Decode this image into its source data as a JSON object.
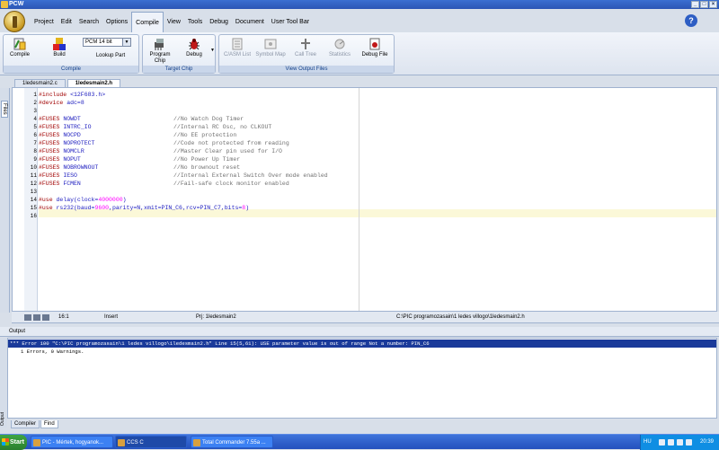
{
  "window": {
    "title": "PCW",
    "buttons": [
      "_",
      "□",
      "×"
    ]
  },
  "menu": {
    "tabs": [
      "Project",
      "Edit",
      "Search",
      "Options",
      "Compile",
      "View",
      "Tools",
      "Debug",
      "Document",
      "User Tool Bar"
    ],
    "active": "Compile",
    "help_glyph": "?"
  },
  "ribbon": {
    "compile_group": {
      "label": "Compile",
      "compile": "Compile",
      "build": "Build",
      "target": "PCM 14 bit",
      "lookup": "Lookup Part"
    },
    "target_group": {
      "label": "Target Chip",
      "program_chip_1": "Program",
      "program_chip_2": "Chip",
      "debug": "Debug"
    },
    "output_group": {
      "label": "View Output Files",
      "c_asm": "C/ASM List",
      "symbol_map": "Symbol Map",
      "call_tree": "Call Tree",
      "statistics": "Statistics",
      "debug_file": "Debug File"
    }
  },
  "sidebar": {
    "files_label": "Files"
  },
  "document_tabs": [
    {
      "label": "1ledesmain2.c",
      "active": false
    },
    {
      "label": "1ledesmain2.h",
      "active": true
    }
  ],
  "editor": {
    "line_numbers": [
      "1",
      "2",
      "3",
      "4",
      "5",
      "6",
      "7",
      "8",
      "9",
      "10",
      "11",
      "12",
      "13",
      "14",
      "15",
      "16"
    ],
    "lines": [
      {
        "a": "#include ",
        "b": "<12F683.h>",
        "c": ""
      },
      {
        "a": "#device ",
        "b": "adc=8",
        "c": ""
      },
      {
        "a": "",
        "b": "",
        "c": ""
      },
      {
        "a": "#FUSES ",
        "b": "NOWDT",
        "c": "//No Watch Dog Timer"
      },
      {
        "a": "#FUSES ",
        "b": "INTRC_IO",
        "c": "//Internal RC Osc, no CLKOUT"
      },
      {
        "a": "#FUSES ",
        "b": "NOCPD",
        "c": "//No EE protection"
      },
      {
        "a": "#FUSES ",
        "b": "NOPROTECT",
        "c": "//Code not protected from reading"
      },
      {
        "a": "#FUSES ",
        "b": "NOMCLR",
        "c": "//Master Clear pin used for I/O"
      },
      {
        "a": "#FUSES ",
        "b": "NOPUT",
        "c": "//No Power Up Timer"
      },
      {
        "a": "#FUSES ",
        "b": "NOBROWNOUT",
        "c": "//No brownout reset"
      },
      {
        "a": "#FUSES ",
        "b": "IESO",
        "c": "//Internal External Switch Over mode enabled"
      },
      {
        "a": "#FUSES ",
        "b": "FCMEN",
        "c": "//Fail-safe clock monitor enabled"
      },
      {
        "a": "",
        "b": "",
        "c": ""
      },
      {
        "a": "#use ",
        "b": "delay(clock=",
        "num": "4000000",
        "end": ")"
      },
      {
        "a": "#use ",
        "b": "rs232(baud=",
        "num": "9600",
        "end": ",parity=N,xmit=PIN_C6,rcv=PIN_C7,bits=",
        "num2": "8",
        "end2": ")"
      },
      {
        "a": "",
        "b": "",
        "c": ""
      }
    ]
  },
  "status_bar": {
    "position": "16:1",
    "mode": "Insert",
    "project": "Prj: 1ledesmain2",
    "path": "C:\\PIC programozasain\\1 ledes villogo\\1ledesmain2.h"
  },
  "output": {
    "header": "Output",
    "strip_label": "Output",
    "error_line": "*** Error 100 \"C:\\PIC programozasain\\1 ledes villogo\\1ledesmain2.h\" Line 15(5,61): USE parameter value is out of range   Not a number: PIN_C6",
    "summary": "1 Errors,  0 Warnings.",
    "tabs": [
      "Compiler",
      "Find"
    ]
  },
  "taskbar": {
    "start": "Start",
    "tasks": [
      "PIC - Mértek, hogyanok...",
      "CCS C",
      "Total Commander 7.55a ..."
    ],
    "active_task": "CCS C",
    "lang": "HU",
    "time": "20:39"
  }
}
